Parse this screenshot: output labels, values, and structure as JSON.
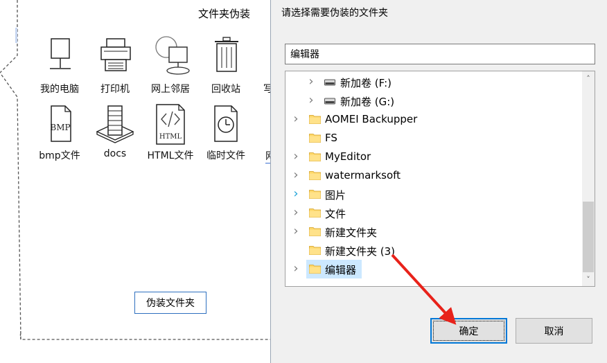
{
  "left_panel": {
    "title": "文件夹伪装",
    "icons_row1": [
      {
        "label": "我的电脑",
        "icon": "computer-icon"
      },
      {
        "label": "打印机",
        "icon": "printer-icon"
      },
      {
        "label": "网上邻居",
        "icon": "network-icon"
      },
      {
        "label": "回收站",
        "icon": "recycle-bin-icon"
      }
    ],
    "icons_row2": [
      {
        "label": "bmp文件",
        "icon": "bmp-file-icon",
        "icon_text": "BMP"
      },
      {
        "label": "docs",
        "icon": "docs-icon"
      },
      {
        "label": "HTML文件",
        "icon": "html-file-icon",
        "icon_text": "HTML"
      },
      {
        "label": "临时文件",
        "icon": "temp-file-icon"
      }
    ],
    "cut_row1": "写",
    "cut_row2": "网",
    "disguise_button": "伪装文件夹"
  },
  "dialog": {
    "prompt": "请选择需要伪装的文件夹",
    "path_value": "编辑器",
    "tree": [
      {
        "label": "新加卷 (F:)",
        "type": "drive",
        "expandable": true,
        "indent": 1
      },
      {
        "label": "新加卷 (G:)",
        "type": "drive",
        "expandable": true,
        "indent": 1
      },
      {
        "label": "AOMEI Backupper",
        "type": "folder",
        "expandable": true,
        "indent": 0
      },
      {
        "label": "FS",
        "type": "folder",
        "expandable": false,
        "indent": 0
      },
      {
        "label": "MyEditor",
        "type": "folder",
        "expandable": true,
        "indent": 0
      },
      {
        "label": "watermarksoft",
        "type": "folder",
        "expandable": true,
        "indent": 0
      },
      {
        "label": "图片",
        "type": "folder",
        "expandable": true,
        "indent": 0,
        "hover": true
      },
      {
        "label": "文件",
        "type": "folder",
        "expandable": true,
        "indent": 0
      },
      {
        "label": "新建文件夹",
        "type": "folder",
        "expandable": true,
        "indent": 0
      },
      {
        "label": "新建文件夹 (3)",
        "type": "folder",
        "expandable": false,
        "indent": 0
      },
      {
        "label": "编辑器",
        "type": "folder",
        "expandable": true,
        "indent": 0,
        "selected": true
      }
    ],
    "ok_button": "确定",
    "cancel_button": "取消"
  },
  "colors": {
    "accent_blue": "#0078d7",
    "selection": "#cce8ff",
    "folder_yellow": "#ffd86a",
    "arrow_red": "#e8221a"
  }
}
